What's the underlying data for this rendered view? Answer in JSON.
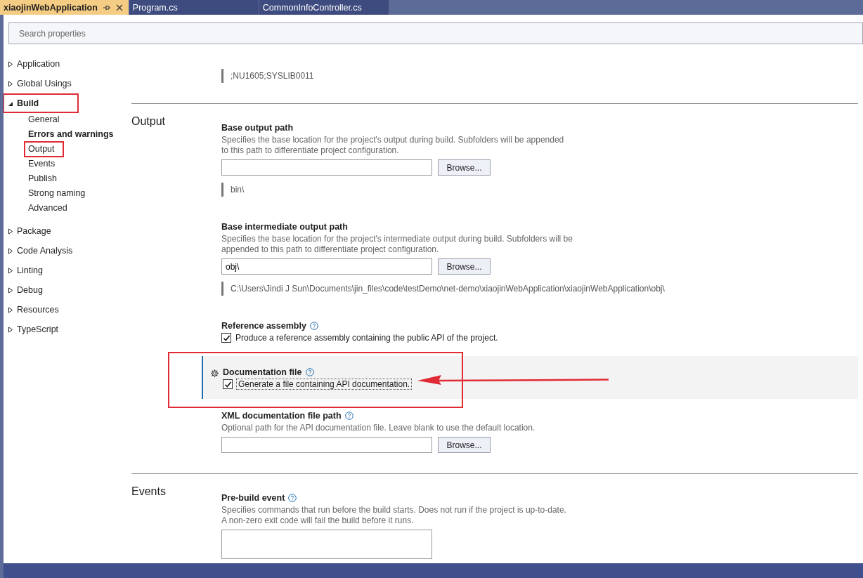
{
  "tabs": [
    {
      "label": "xiaojinWebApplication",
      "selected": true,
      "pinnable": true,
      "closable": true
    },
    {
      "label": "Program.cs",
      "selected": false
    },
    {
      "label": "CommonInfoController.cs",
      "selected": false
    }
  ],
  "search": {
    "placeholder": "Search properties"
  },
  "sidebar": {
    "items": [
      {
        "label": "Application",
        "expanded": false,
        "highlighted": false
      },
      {
        "label": "Global Usings",
        "expanded": false,
        "highlighted": false
      },
      {
        "label": "Build",
        "expanded": true,
        "highlighted": true,
        "children": [
          {
            "label": "General",
            "selected": false,
            "highlighted": false
          },
          {
            "label": "Errors and warnings",
            "selected": true,
            "highlighted": false
          },
          {
            "label": "Output",
            "selected": false,
            "highlighted": true
          },
          {
            "label": "Events",
            "selected": false,
            "highlighted": false
          },
          {
            "label": "Publish",
            "selected": false,
            "highlighted": false
          },
          {
            "label": "Strong naming",
            "selected": false,
            "highlighted": false
          },
          {
            "label": "Advanced",
            "selected": false,
            "highlighted": false
          }
        ]
      },
      {
        "label": "Package",
        "expanded": false,
        "highlighted": false
      },
      {
        "label": "Code Analysis",
        "expanded": false,
        "highlighted": false
      },
      {
        "label": "Linting",
        "expanded": false,
        "highlighted": false
      },
      {
        "label": "Debug",
        "expanded": false,
        "highlighted": false
      },
      {
        "label": "Resources",
        "expanded": false,
        "highlighted": false
      },
      {
        "label": "TypeScript",
        "expanded": false,
        "highlighted": false
      }
    ]
  },
  "sections": [
    {
      "settings": [
        {
          "kind": "note",
          "note": ";NU1605;SYSLIB0011"
        }
      ]
    },
    {
      "label": "Output",
      "settings": [
        {
          "kind": "path",
          "title": "Base output path",
          "description": "Specifies the base location for the project's output during build. Subfolders will be appended to this path to differentiate project configuration.",
          "button": "Browse...",
          "note": "bin\\"
        },
        {
          "kind": "path",
          "title": "Base intermediate output path",
          "description": "Specifies the base location for the project's intermediate output during build. Subfolders will be appended to this path to differentiate project configuration.",
          "value": "obj\\",
          "button": "Browse...",
          "note": "C:\\Users\\Jindi J Sun\\Documents\\jin_files\\code\\testDemo\\net-demo\\xiaojinWebApplication\\xiaojinWebApplication\\obj\\"
        },
        {
          "kind": "checkbox",
          "title": "Reference assembly",
          "help": true,
          "checkbox": {
            "label": "Produce a reference assembly containing the public API of the project.",
            "checked": true
          }
        },
        {
          "kind": "checkbox",
          "title": "Documentation file",
          "help": true,
          "focused": true,
          "highlighted": true,
          "checkbox": {
            "label": "Generate a file containing API documentation.",
            "checked": true
          }
        },
        {
          "kind": "path",
          "title": "XML documentation file path",
          "help": true,
          "description": "Optional path for the API documentation file. Leave blank to use the default location.",
          "button": "Browse..."
        }
      ]
    },
    {
      "label": "Events",
      "settings": [
        {
          "kind": "textarea",
          "title": "Pre-build event",
          "help": true,
          "description": "Specifies commands that run before the build starts. Does not run if the project is up-to-date. A non-zero exit code will fail the build before it runs."
        }
      ]
    }
  ]
}
